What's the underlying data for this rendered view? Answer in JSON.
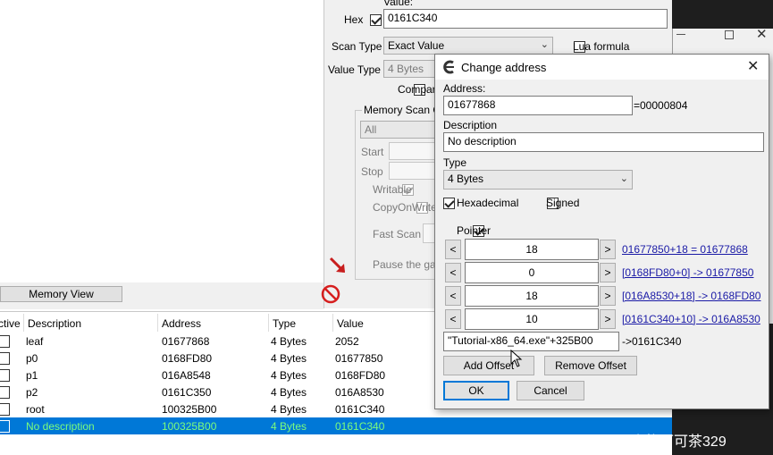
{
  "main_window": {
    "value_label": "Value:",
    "hex_label": "Hex",
    "hex_checked": true,
    "value": "0161C340",
    "scan_type_label": "Scan Type",
    "scan_type_value": "Exact Value",
    "lua_formula_label": "Lua formula",
    "value_type_label": "Value Type",
    "value_type_value": "4 Bytes",
    "compare_label": "Compar",
    "memory_scan_label": "Memory Scan O",
    "memory_region_value": "All",
    "start_label": "Start",
    "stop_label": "Stop",
    "writable_label": "Writable",
    "copy_on_write_label": "CopyOnWrite",
    "fast_scan_label": "Fast Scan",
    "pause_label": "Pause the ga",
    "memory_view_button": "Memory View"
  },
  "address_table": {
    "columns": [
      "ctive",
      "Description",
      "Address",
      "Type",
      "Value"
    ],
    "rows": [
      {
        "description": "leaf",
        "address": "01677868",
        "type": "4 Bytes",
        "value": "2052",
        "selected": false
      },
      {
        "description": "p0",
        "address": "0168FD80",
        "type": "4 Bytes",
        "value": "01677850",
        "selected": false
      },
      {
        "description": "p1",
        "address": "016A8548",
        "type": "4 Bytes",
        "value": "0168FD80",
        "selected": false
      },
      {
        "description": "p2",
        "address": "0161C350",
        "type": "4 Bytes",
        "value": "016A8530",
        "selected": false
      },
      {
        "description": "root",
        "address": "100325B00",
        "type": "4 Bytes",
        "value": "0161C340",
        "selected": false
      },
      {
        "description": "No description",
        "address": "100325B00",
        "type": "4 Bytes",
        "value": "0161C340",
        "selected": true
      }
    ]
  },
  "dialog": {
    "title": "Change address",
    "address_label": "Address:",
    "address_value": "01677868",
    "address_result": "=00000804",
    "description_label": "Description",
    "description_value": "No description",
    "type_label": "Type",
    "type_value": "4 Bytes",
    "hexadecimal_label": "Hexadecimal",
    "hexadecimal_checked": true,
    "signed_label": "Signed",
    "signed_checked": false,
    "pointer_label": "Pointer",
    "pointer_checked": true,
    "offsets": [
      {
        "value": "18",
        "result": "01677850+18 = 01677868"
      },
      {
        "value": "0",
        "result": "[0168FD80+0] -> 01677850"
      },
      {
        "value": "18",
        "result": "[016A8530+18] -> 0168FD80"
      },
      {
        "value": "10",
        "result": "[0161C340+10] -> 016A8530"
      }
    ],
    "decrease_label": "<",
    "increase_label": ">",
    "base_address": "\"Tutorial-x86_64.exe\"+325B00",
    "base_result": "->0161C340",
    "add_offset_label": "Add Offset",
    "remove_offset_label": "Remove Offset",
    "ok_label": "OK",
    "cancel_label": "Cancel"
  },
  "watermark": "CSDN @小熊可可茶329"
}
